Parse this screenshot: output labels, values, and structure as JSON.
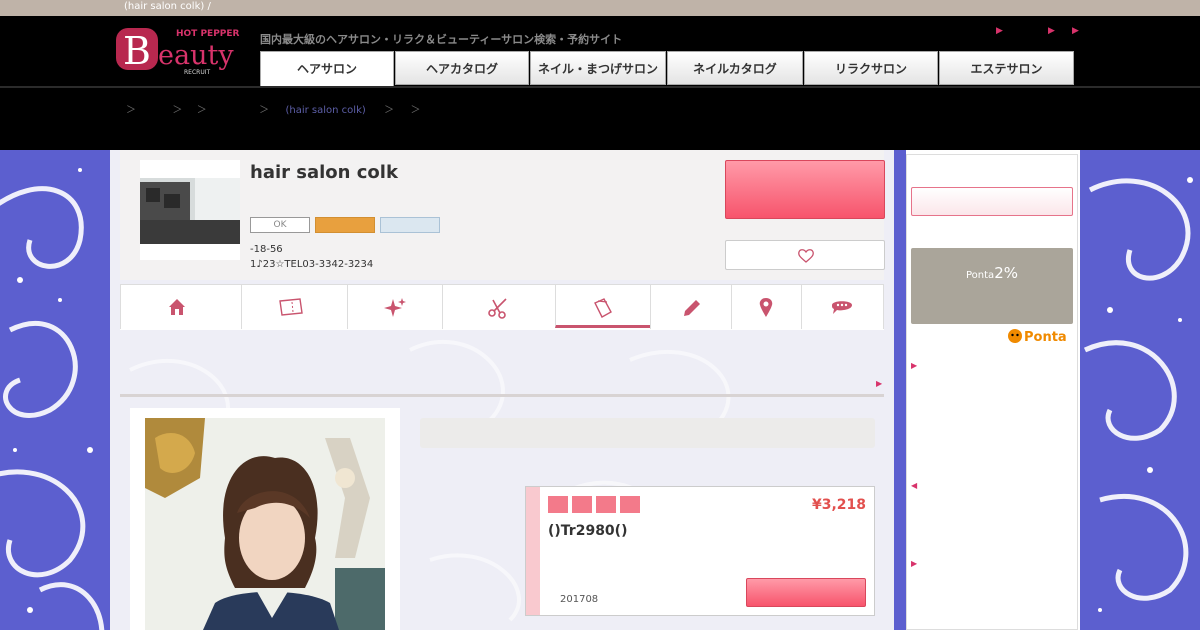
{
  "topbar": {
    "crumb": "(hair salon colk) /"
  },
  "header": {
    "tagline": "国内最大級のヘアサロン・リラク＆ビューティーサロン検索・予約サイト",
    "logo": {
      "top": "HOT PEPPER",
      "letter": "B",
      "word": "eauty",
      "sub": "RECRUIT"
    },
    "top_arrow_icons": [
      "arrow-right",
      "arrow-right",
      "arrow-right"
    ]
  },
  "tabs": [
    {
      "label": "ヘアサロン",
      "active": true
    },
    {
      "label": "ヘアカタログ"
    },
    {
      "label": "ネイル・まつげサロン"
    },
    {
      "label": "ネイルカタログ"
    },
    {
      "label": "リラクサロン"
    },
    {
      "label": "エステサロン"
    }
  ],
  "breadcrumb": {
    "sep": "＞",
    "link": "(hair salon colk)"
  },
  "salon": {
    "name": "hair salon colk",
    "badge_ok": "OK",
    "address": "-18-56",
    "access": "1♪23☆TEL03-3342-3234"
  },
  "nav_icons": [
    "home-icon",
    "coupon-icon",
    "sparkle-icon",
    "scissors-icon",
    "catalog-icon",
    "pencil-icon",
    "map-pin-icon",
    "chat-icon"
  ],
  "coupon": {
    "price": "¥3,218",
    "title": "()Tr2980()",
    "date": "201708",
    "tag_count": 4
  },
  "sidebar": {
    "ponta_small": "Ponta",
    "ponta_rate": "2%",
    "ponta_logo": "Ponta"
  },
  "colors": {
    "accent": "#d8336b",
    "price": "#e2504e",
    "background": "#5c5fcf"
  }
}
